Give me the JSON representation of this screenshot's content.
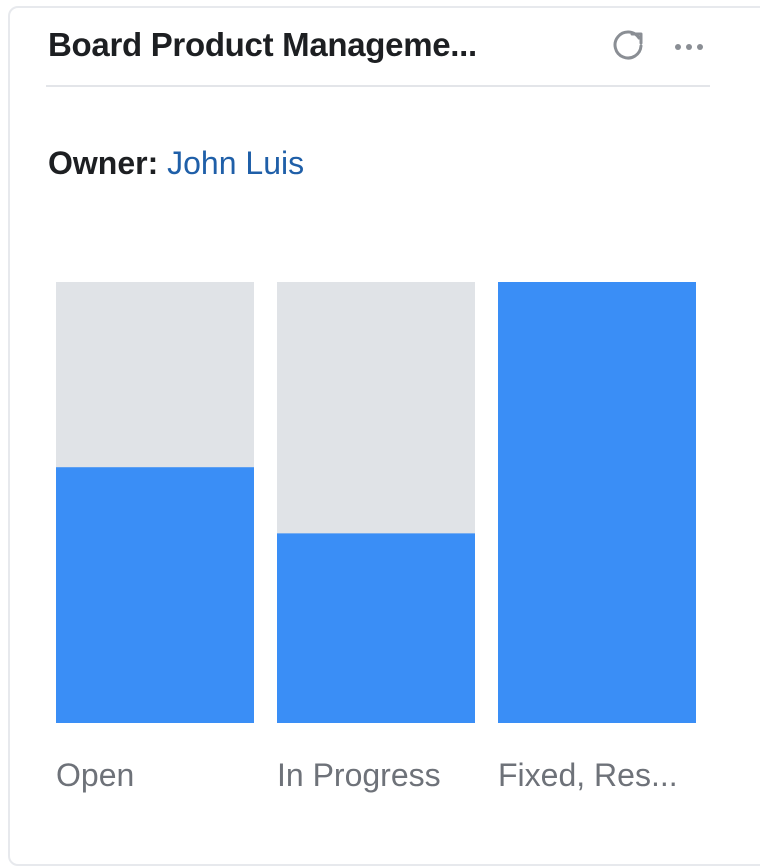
{
  "card": {
    "title": "Board Product Manageme...",
    "owner_label": "Owner:",
    "owner_name": "John Luis",
    "refresh_icon": "refresh-icon",
    "more_icon": "more-horizontal-icon"
  },
  "colors": {
    "filled": "#3a8ef6",
    "track": "#e0e3e7",
    "link": "#1f5fa8"
  },
  "chart_data": {
    "type": "bar",
    "categories": [
      "Open",
      "In Progress",
      "Fixed, Res..."
    ],
    "values": [
      0.58,
      0.43,
      1.0
    ],
    "ylim": [
      0,
      1
    ]
  }
}
